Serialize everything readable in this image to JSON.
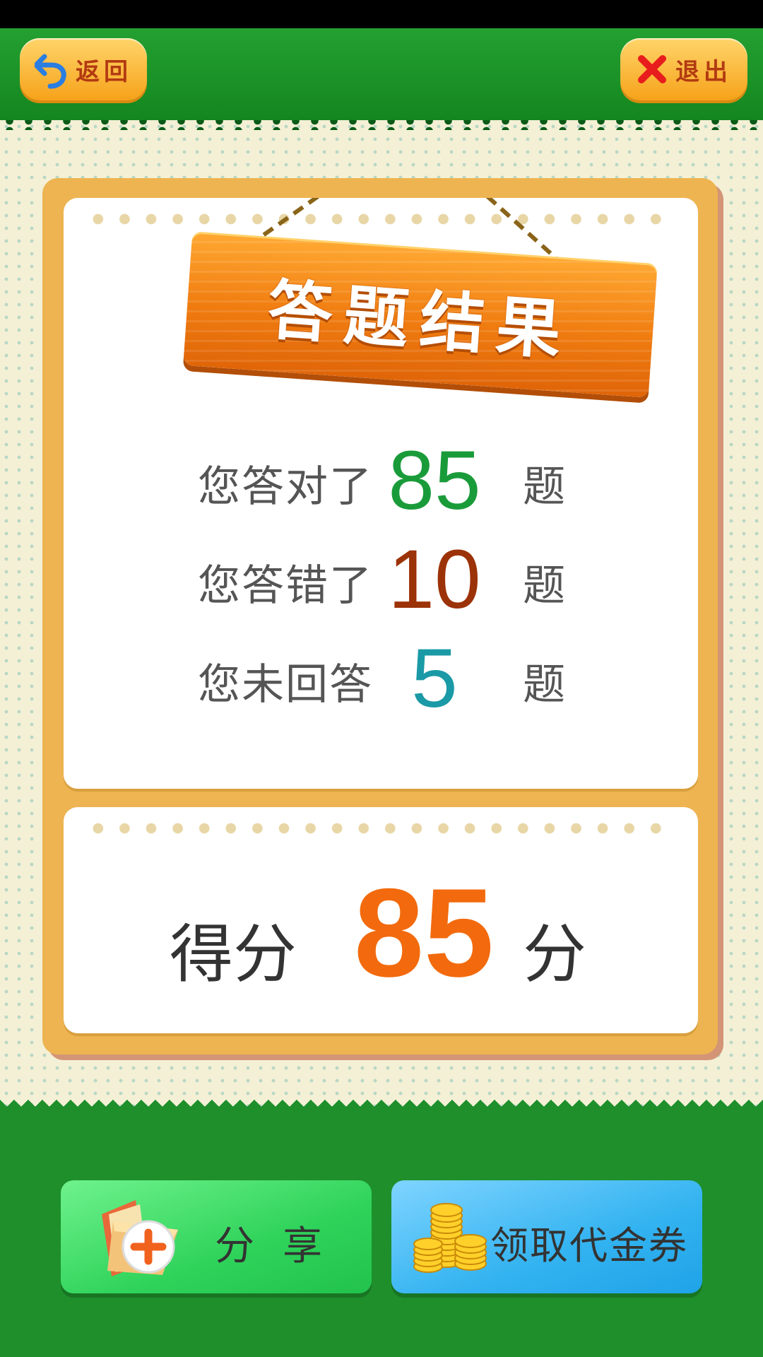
{
  "header": {
    "back_label": "返回",
    "exit_label": "退出"
  },
  "result": {
    "title": "答题结果",
    "stats": [
      {
        "label": "您答对了",
        "value": "85",
        "unit": "题",
        "color": "#1a9b3a"
      },
      {
        "label": "您答错了",
        "value": "10",
        "unit": "题",
        "color": "#9c3208"
      },
      {
        "label": "您未回答",
        "value": "5",
        "unit": "题",
        "color": "#1a9aa6"
      }
    ],
    "score_label": "得分",
    "score_value": "85",
    "score_unit": "分"
  },
  "actions": {
    "share_label": "分享",
    "coupon_label": "领取代金券"
  },
  "colors": {
    "green_bg": "#1e8f2b",
    "orange_button": "#f6a21a",
    "score_orange": "#f26a0d"
  },
  "icons": {
    "back": "back-arrow-icon",
    "exit": "close-x-icon",
    "share": "folder-plus-icon",
    "coupon": "gold-coins-icon"
  }
}
